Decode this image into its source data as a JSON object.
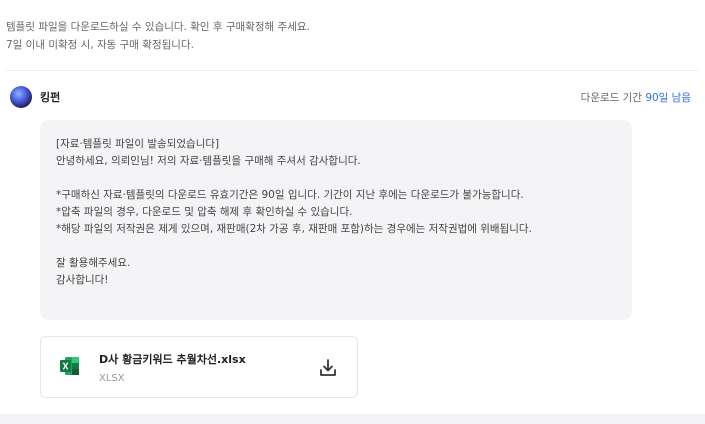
{
  "notice": {
    "line1": "템플릿 파일을 다운로드하실 수 있습니다. 확인 후 구매확정해 주세요.",
    "line2": "7일 이내 미확정 시, 자동 구매 확정됩니다."
  },
  "seller": {
    "name": "킹펀",
    "download_period_prefix": "다운로드 기간 ",
    "download_period_days": "90일 남음"
  },
  "message": {
    "lines": [
      "[자료·템플릿 파일이 발송되었습니다]",
      "안녕하세요, 의뢰인님! 저의 자료·템플릿을 구매해 주셔서 감사합니다.",
      "",
      "*구매하신 자료·템플릿의 다운로드 유효기간은 90일 입니다. 기간이 지난 후에는 다운로드가 불가능합니다.",
      "*압축 파일의 경우, 다운로드 및 압축 해제 후 확인하실 수 있습니다.",
      "*해당 파일의 저작권은 제게 있으며, 재판매(2차 가공 후, 재판매 포함)하는 경우에는 저작권법에 위배됩니다.",
      "",
      "잘 활용해주세요.",
      "감사합니다!"
    ]
  },
  "file": {
    "name": "D사 황금키워드 추월차선.xlsx",
    "type": "XLSX",
    "icon": "excel-file-icon",
    "accent": "#1f7a45"
  },
  "colors": {
    "link_blue": "#2f6fe4",
    "bubble_bg": "#f4f4f6"
  }
}
